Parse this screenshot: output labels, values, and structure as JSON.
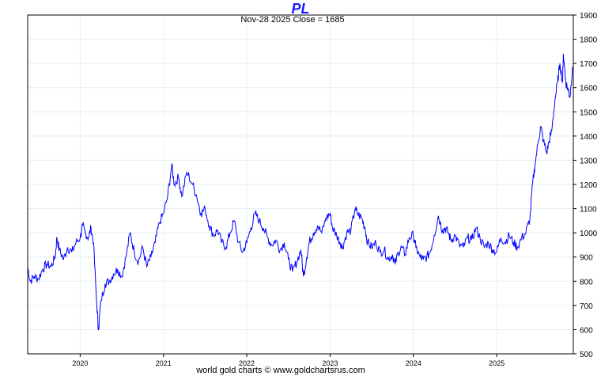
{
  "chart_data": {
    "type": "line",
    "title": "PL",
    "subtitle": "Nov-28  2025    Close = 1685",
    "footer": "world gold charts © www.goldchartsrus.com",
    "xlabel": "",
    "ylabel": "",
    "ylim": [
      500,
      1900
    ],
    "xlim": [
      2019.37,
      2025.92
    ],
    "yticks": [
      500,
      600,
      700,
      800,
      900,
      1000,
      1100,
      1200,
      1300,
      1400,
      1500,
      1600,
      1700,
      1800,
      1900
    ],
    "xticks": [
      {
        "label": "2020",
        "value": 2020
      },
      {
        "label": "2021",
        "value": 2021
      },
      {
        "label": "2022",
        "value": 2022
      },
      {
        "label": "2023",
        "value": 2023
      },
      {
        "label": "2024",
        "value": 2024
      },
      {
        "label": "2025",
        "value": 2025
      }
    ],
    "grid": true,
    "line_color": "#0000ff",
    "series": [
      {
        "name": "PL",
        "x": [
          2019.37,
          2019.4,
          2019.45,
          2019.5,
          2019.55,
          2019.6,
          2019.65,
          2019.7,
          2019.72,
          2019.75,
          2019.8,
          2019.85,
          2019.9,
          2019.95,
          2020.0,
          2020.03,
          2020.06,
          2020.1,
          2020.13,
          2020.16,
          2020.2,
          2020.22,
          2020.25,
          2020.3,
          2020.35,
          2020.4,
          2020.45,
          2020.5,
          2020.55,
          2020.6,
          2020.65,
          2020.7,
          2020.75,
          2020.8,
          2020.85,
          2020.9,
          2020.95,
          2021.0,
          2021.05,
          2021.1,
          2021.13,
          2021.18,
          2021.22,
          2021.28,
          2021.35,
          2021.4,
          2021.45,
          2021.5,
          2021.55,
          2021.6,
          2021.65,
          2021.7,
          2021.75,
          2021.8,
          2021.85,
          2021.9,
          2021.95,
          2022.0,
          2022.05,
          2022.1,
          2022.15,
          2022.2,
          2022.25,
          2022.3,
          2022.35,
          2022.4,
          2022.45,
          2022.5,
          2022.55,
          2022.6,
          2022.65,
          2022.68,
          2022.72,
          2022.75,
          2022.8,
          2022.85,
          2022.9,
          2022.95,
          2023.0,
          2023.03,
          2023.08,
          2023.12,
          2023.15,
          2023.2,
          2023.25,
          2023.3,
          2023.33,
          2023.38,
          2023.42,
          2023.45,
          2023.5,
          2023.55,
          2023.6,
          2023.65,
          2023.7,
          2023.75,
          2023.78,
          2023.82,
          2023.86,
          2023.9,
          2023.95,
          2024.0,
          2024.03,
          2024.08,
          2024.12,
          2024.16,
          2024.2,
          2024.25,
          2024.3,
          2024.35,
          2024.38,
          2024.42,
          2024.45,
          2024.5,
          2024.55,
          2024.6,
          2024.65,
          2024.7,
          2024.75,
          2024.8,
          2024.85,
          2024.9,
          2024.95,
          2025.0,
          2025.05,
          2025.1,
          2025.15,
          2025.2,
          2025.25,
          2025.3,
          2025.35,
          2025.4,
          2025.43,
          2025.46,
          2025.5,
          2025.53,
          2025.56,
          2025.6,
          2025.63,
          2025.66,
          2025.7,
          2025.73,
          2025.76,
          2025.79,
          2025.8,
          2025.83,
          2025.86,
          2025.88,
          2025.91
        ],
        "values": [
          860,
          800,
          820,
          810,
          850,
          870,
          860,
          900,
          980,
          930,
          890,
          940,
          920,
          960,
          980,
          1030,
          1000,
          980,
          1020,
          960,
          700,
          600,
          720,
          790,
          800,
          830,
          850,
          820,
          900,
          1000,
          920,
          880,
          940,
          860,
          900,
          960,
          1040,
          1080,
          1150,
          1280,
          1200,
          1230,
          1150,
          1250,
          1200,
          1150,
          1080,
          1100,
          1030,
          990,
          1010,
          960,
          940,
          1000,
          1050,
          960,
          920,
          960,
          1020,
          1080,
          1050,
          1020,
          980,
          950,
          970,
          930,
          960,
          890,
          840,
          880,
          930,
          820,
          900,
          960,
          1000,
          1030,
          1000,
          1060,
          1080,
          1020,
          990,
          960,
          940,
          1000,
          1010,
          1100,
          1080,
          1060,
          1020,
          960,
          940,
          960,
          920,
          930,
          890,
          910,
          870,
          920,
          940,
          910,
          980,
          990,
          940,
          900,
          890,
          900,
          920,
          990,
          1070,
          1010,
          1020,
          1000,
          970,
          990,
          950,
          940,
          980,
          970,
          1020,
          980,
          940,
          960,
          930,
          920,
          980,
          960,
          990,
          960,
          940,
          980,
          1000,
          1060,
          1200,
          1280,
          1380,
          1440,
          1380,
          1330,
          1380,
          1420,
          1550,
          1620,
          1700,
          1620,
          1740,
          1620,
          1590,
          1560,
          1685
        ]
      }
    ]
  }
}
